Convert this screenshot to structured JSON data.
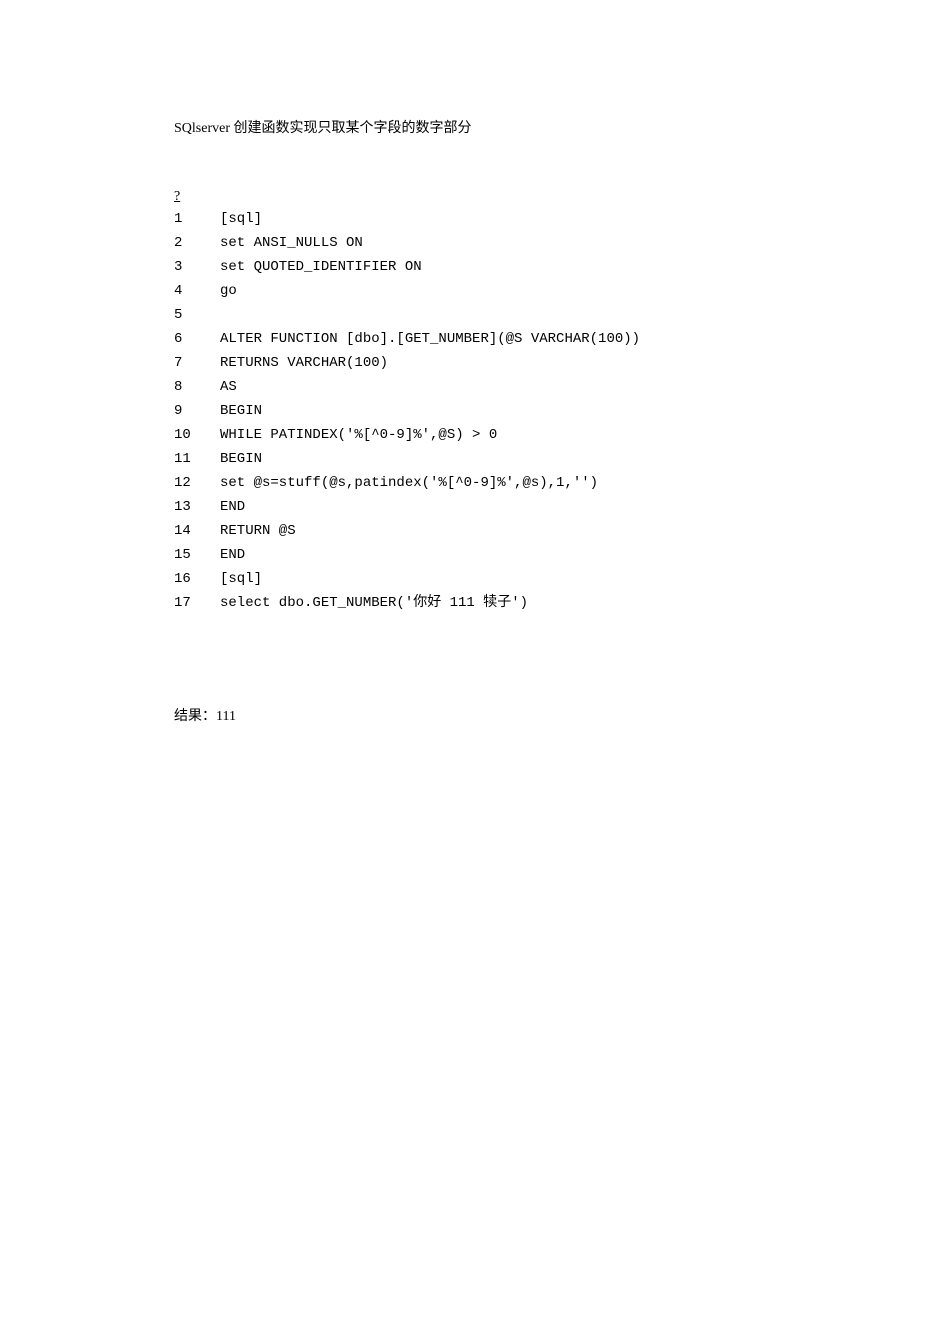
{
  "title": "SQlserver 创建函数实现只取某个字段的数字部分",
  "question_mark": "?",
  "code_lines": [
    {
      "n": "1",
      "text": "[sql]"
    },
    {
      "n": "2",
      "text": "set ANSI_NULLS ON"
    },
    {
      "n": "3",
      "text": "set QUOTED_IDENTIFIER ON"
    },
    {
      "n": "4",
      "text": "go"
    },
    {
      "n": "5",
      "text": ""
    },
    {
      "n": "6",
      "text": "ALTER FUNCTION [dbo].[GET_NUMBER](@S VARCHAR(100))"
    },
    {
      "n": "7",
      "text": "RETURNS VARCHAR(100)"
    },
    {
      "n": "8",
      "text": "AS"
    },
    {
      "n": "9",
      "text": "BEGIN"
    },
    {
      "n": "10",
      "text": "WHILE PATINDEX('%[^0-9]%',@S) > 0"
    },
    {
      "n": "11",
      "text": "BEGIN"
    },
    {
      "n": "12",
      "text": "set @s=stuff(@s,patindex('%[^0-9]%',@s),1,'')"
    },
    {
      "n": "13",
      "text": "END"
    },
    {
      "n": "14",
      "text": "RETURN @S"
    },
    {
      "n": "15",
      "text": "END"
    },
    {
      "n": "16",
      "text": "[sql]"
    },
    {
      "n": "17",
      "text": "select dbo.GET_NUMBER('你好 111 犊子')"
    }
  ],
  "result": "结果：111"
}
